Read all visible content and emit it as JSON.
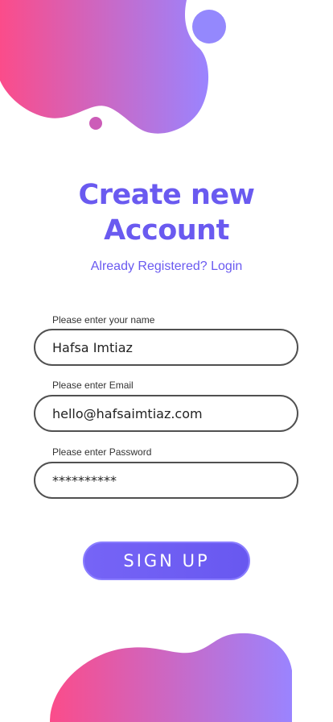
{
  "title": {
    "line1": "Create new",
    "line2": "Account"
  },
  "login_link": "Already Registered? Login",
  "form": {
    "name": {
      "label": "Please enter your name",
      "value": "Hafsa Imtiaz"
    },
    "email": {
      "label": "Please enter Email",
      "value": "hello@hafsaimtiaz.com"
    },
    "password": {
      "label": "Please enter Password",
      "value": "**********"
    }
  },
  "signup_button": "SIGN UP",
  "colors": {
    "accent": "#6a5af0",
    "gradient_start": "#fb4c8a",
    "gradient_end": "#9a84ff"
  }
}
